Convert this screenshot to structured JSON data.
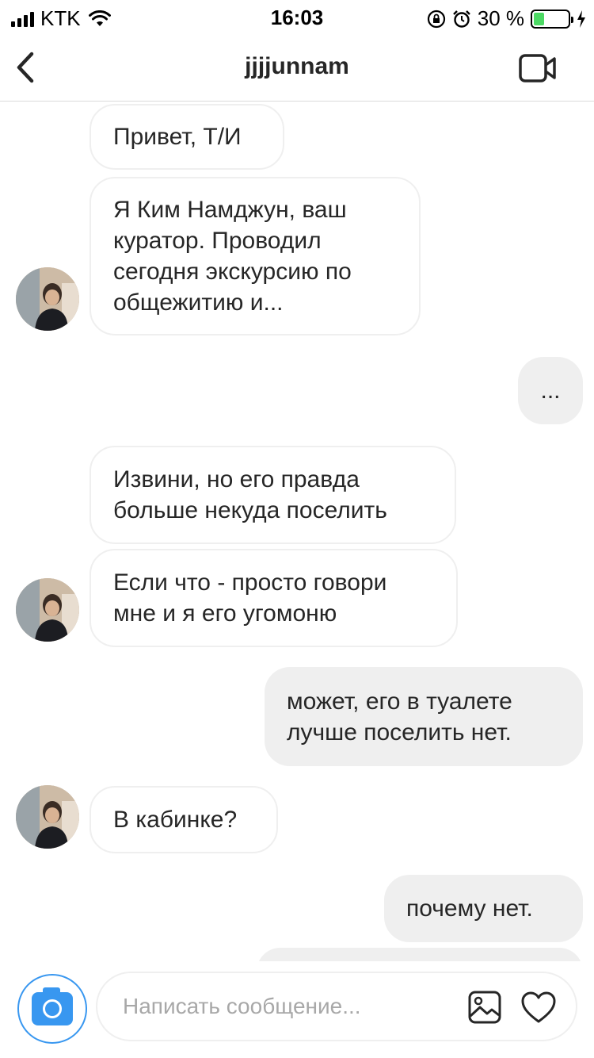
{
  "status_bar": {
    "carrier": "KTK",
    "time": "16:03",
    "battery_percent": "30 %",
    "battery_level": 0.3
  },
  "header": {
    "title": "jjjjunnam"
  },
  "messages": [
    {
      "direction": "in",
      "text": "Привет, Т/И"
    },
    {
      "direction": "in",
      "text": "Я Ким Намджун, ваш куратор. Проводил сегодня экскурсию по общежитию и..."
    },
    {
      "direction": "out",
      "text": "..."
    },
    {
      "direction": "in",
      "text": "Извини, но его правда больше некуда поселить"
    },
    {
      "direction": "in",
      "text": "Если что - просто говори мне и я его угомоню"
    },
    {
      "direction": "out",
      "text": "может, его в туалете лучше поселить нет."
    },
    {
      "direction": "in",
      "text": "В кабинке?"
    },
    {
      "direction": "out",
      "text": "почему нет."
    },
    {
      "direction": "out",
      "text": ""
    }
  ],
  "composer": {
    "placeholder": "Написать сообщение..."
  },
  "colors": {
    "accent": "#3897f0",
    "outgoing_bubble": "#efefef",
    "incoming_border": "#efefef",
    "battery": "#4cd964"
  }
}
